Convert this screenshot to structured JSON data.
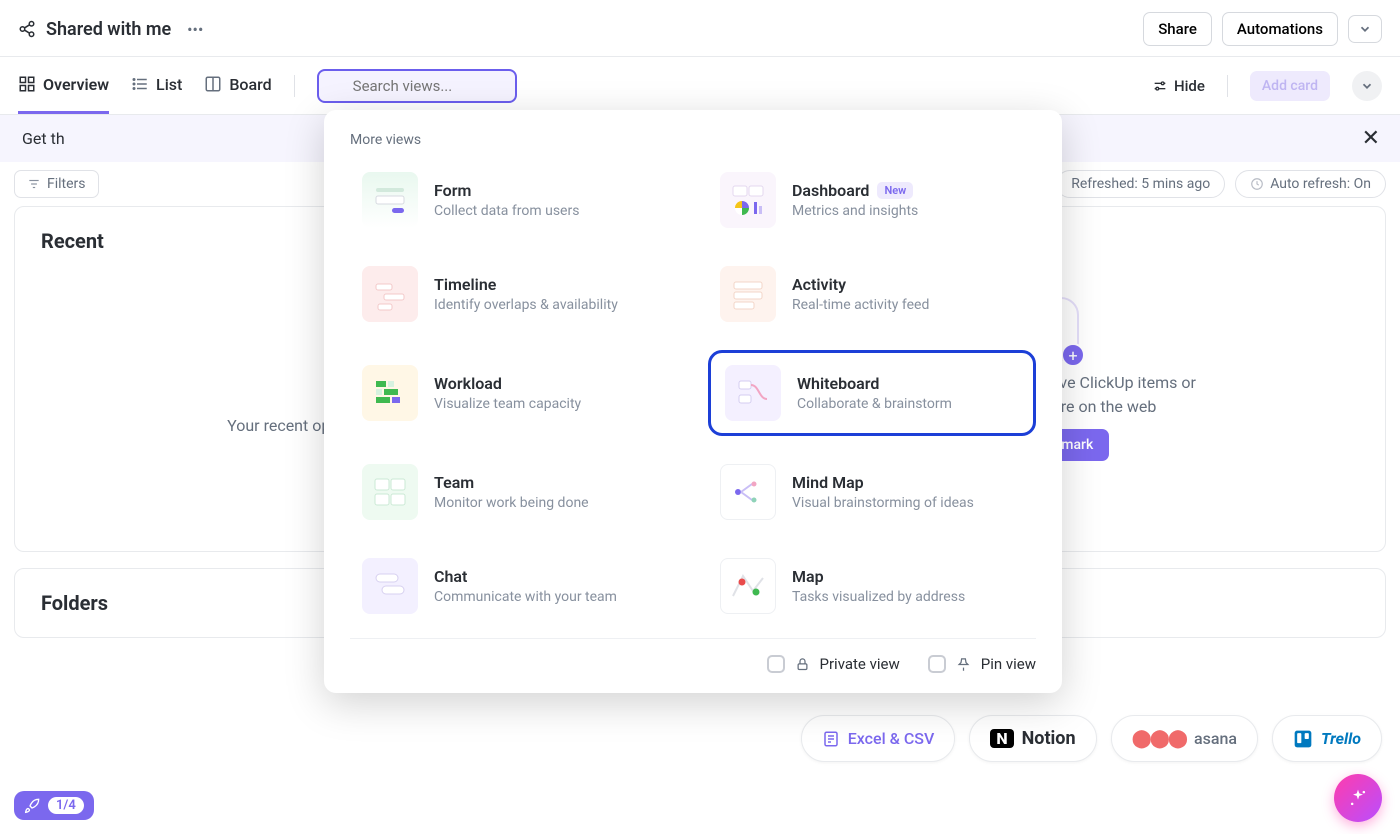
{
  "header": {
    "title": "Shared with me",
    "share_btn": "Share",
    "automations_btn": "Automations"
  },
  "tabs": {
    "overview": "Overview",
    "list": "List",
    "board": "Board",
    "search_placeholder": "Search views...",
    "hide": "Hide",
    "add_card": "Add card"
  },
  "banner": {
    "text_prefix": "Get th"
  },
  "toolbar": {
    "filters": "Filters",
    "refreshed": "Refreshed: 5 mins ago",
    "auto_refresh": "Auto refresh: On"
  },
  "recent": {
    "title": "Recent",
    "empty": "Your recent opened items will show"
  },
  "bookmarks": {
    "desc1": "e the easiest way to save ClickUp items or",
    "desc2": "RLs from anywhere on the web",
    "button": "Add Bookmark"
  },
  "folders": {
    "title": "Folders"
  },
  "imports": {
    "excel": "Excel & CSV",
    "notion": "Notion",
    "asana": "asana",
    "trello": "Trello"
  },
  "rocket": {
    "count": "1/4"
  },
  "popup": {
    "title": "More views",
    "views": [
      {
        "name": "Form",
        "desc": "Collect data from users"
      },
      {
        "name": "Dashboard",
        "desc": "Metrics and insights",
        "badge": "New"
      },
      {
        "name": "Timeline",
        "desc": "Identify overlaps & availability"
      },
      {
        "name": "Activity",
        "desc": "Real-time activity feed"
      },
      {
        "name": "Workload",
        "desc": "Visualize team capacity"
      },
      {
        "name": "Whiteboard",
        "desc": "Collaborate & brainstorm"
      },
      {
        "name": "Team",
        "desc": "Monitor work being done"
      },
      {
        "name": "Mind Map",
        "desc": "Visual brainstorming of ideas"
      },
      {
        "name": "Chat",
        "desc": "Communicate with your team"
      },
      {
        "name": "Map",
        "desc": "Tasks visualized by address"
      }
    ],
    "private": "Private view",
    "pin": "Pin view"
  }
}
